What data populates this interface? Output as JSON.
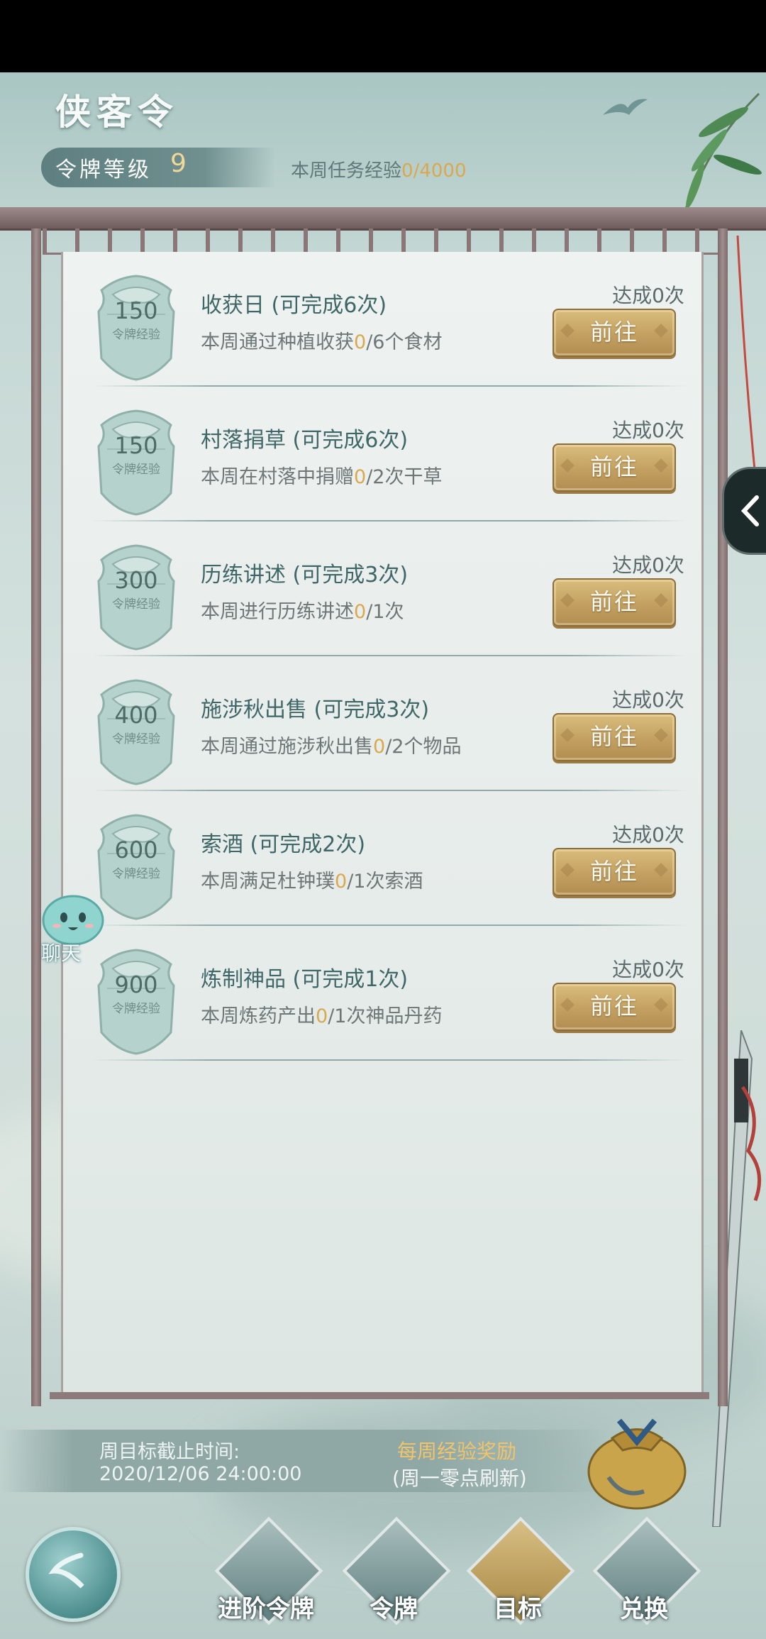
{
  "header": {
    "title": "侠客令",
    "level_label": "令牌等级",
    "level_value": "9",
    "weekly_exp_label": "本周任务经验",
    "weekly_exp_current": "0",
    "weekly_exp_sep": "/4000"
  },
  "tasks": [
    {
      "exp": "150",
      "exp_label": "令牌经验",
      "title": "收获日 (可完成6次)",
      "desc_pre": "本周通过种植收获",
      "desc_hl": "0",
      "desc_post": "/6个食材",
      "done": "达成0次",
      "button": "前往"
    },
    {
      "exp": "150",
      "exp_label": "令牌经验",
      "title": "村落捐草 (可完成6次)",
      "desc_pre": "本周在村落中捐赠",
      "desc_hl": "0",
      "desc_post": "/2次干草",
      "done": "达成0次",
      "button": "前往"
    },
    {
      "exp": "300",
      "exp_label": "令牌经验",
      "title": "历练讲述 (可完成3次)",
      "desc_pre": "本周进行历练讲述",
      "desc_hl": "0",
      "desc_post": "/1次",
      "done": "达成0次",
      "button": "前往"
    },
    {
      "exp": "400",
      "exp_label": "令牌经验",
      "title": "施涉秋出售 (可完成3次)",
      "desc_pre": "本周通过施涉秋出售",
      "desc_hl": "0",
      "desc_post": "/2个物品",
      "done": "达成0次",
      "button": "前往"
    },
    {
      "exp": "600",
      "exp_label": "令牌经验",
      "title": "索酒 (可完成2次)",
      "desc_pre": "本周满足杜钟璞",
      "desc_hl": "0",
      "desc_post": "/1次索酒",
      "done": "达成0次",
      "button": "前往"
    },
    {
      "exp": "900",
      "exp_label": "令牌经验",
      "title": "炼制神品 (可完成1次)",
      "desc_pre": "本周炼药产出",
      "desc_hl": "0",
      "desc_post": "/1次神品丹药",
      "done": "达成0次",
      "button": "前往"
    }
  ],
  "chat": {
    "label": "聊天"
  },
  "footer": {
    "deadline_label": "周目标截止时间:",
    "deadline_time": "2020/12/06 24:00:00",
    "reward_title": "每周经验奖励",
    "reward_sub": "(周一零点刷新)"
  },
  "nav": [
    {
      "label": "进阶令牌",
      "icon": "advanced-token-icon",
      "active": false
    },
    {
      "label": "令牌",
      "icon": "token-icon",
      "active": false
    },
    {
      "label": "目标",
      "icon": "target-icon",
      "active": true
    },
    {
      "label": "兑换",
      "icon": "exchange-icon",
      "active": false
    }
  ],
  "colors": {
    "accent_gold": "#d9a84f",
    "button_gold": "#c3a062",
    "title_teal": "#3f6767"
  }
}
